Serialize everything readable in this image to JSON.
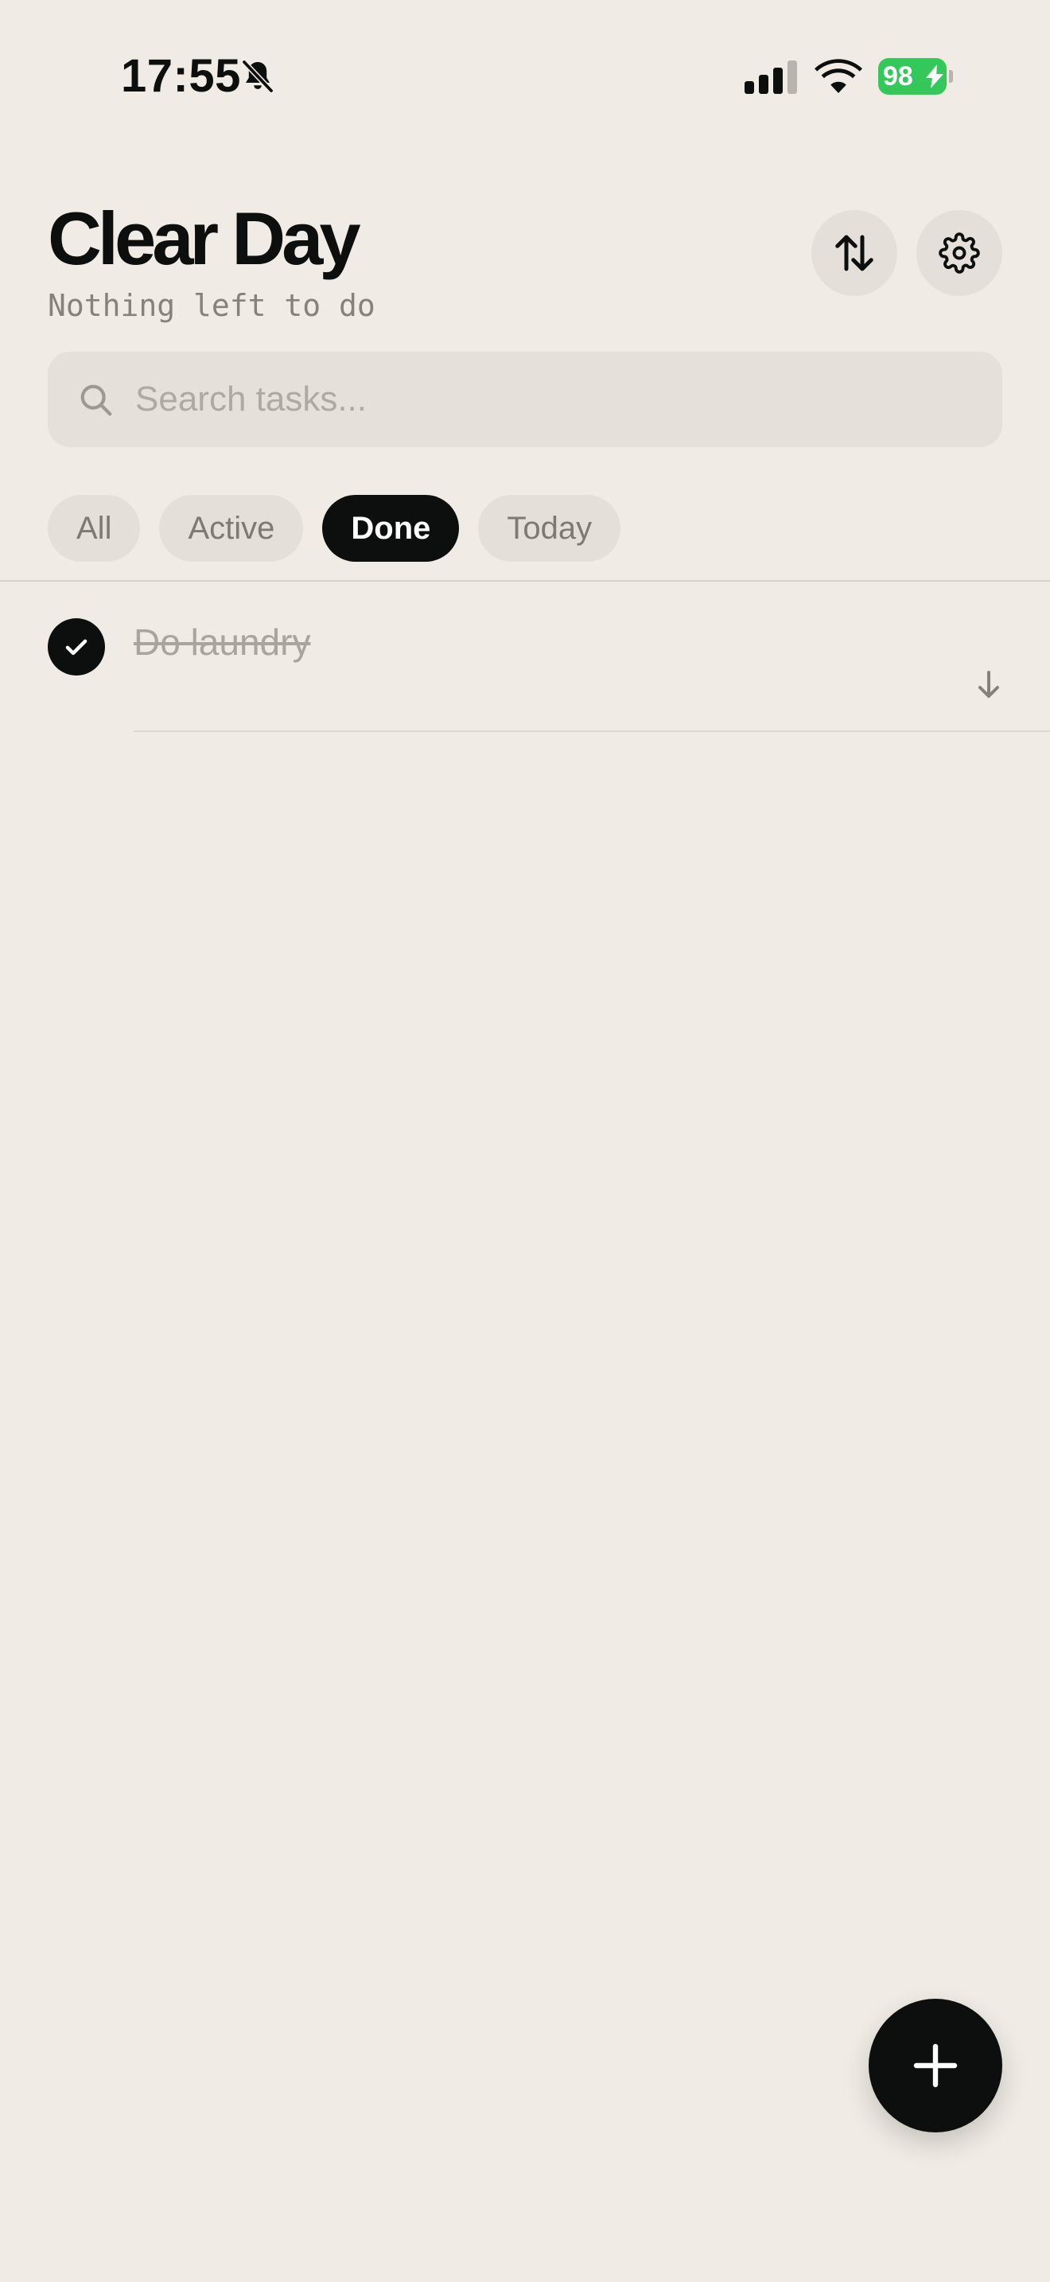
{
  "status_bar": {
    "time": "17:55",
    "battery_level": "98",
    "icons": [
      "bell-slash-icon",
      "cellular-signal-icon",
      "wifi-icon",
      "battery-charging-icon"
    ],
    "battery_color": "#34c759"
  },
  "header": {
    "title": "Clear Day",
    "subtitle": "Nothing left to do",
    "sort_icon": "sort-arrows-icon",
    "settings_icon": "gear-icon"
  },
  "search": {
    "placeholder": "Search tasks...",
    "value": ""
  },
  "filters": {
    "items": [
      {
        "label": "All"
      },
      {
        "label": "Active"
      },
      {
        "label": "Done"
      },
      {
        "label": "Today"
      }
    ],
    "selected": "Done"
  },
  "tasks": [
    {
      "title": "Do laundry",
      "completed": true
    }
  ],
  "fab": {
    "icon": "plus-icon"
  },
  "colors": {
    "background": "#f0ece5",
    "accent": "#0d0f0e",
    "chip_background": "#e4e0d9",
    "muted_text": "#a9a59e"
  }
}
